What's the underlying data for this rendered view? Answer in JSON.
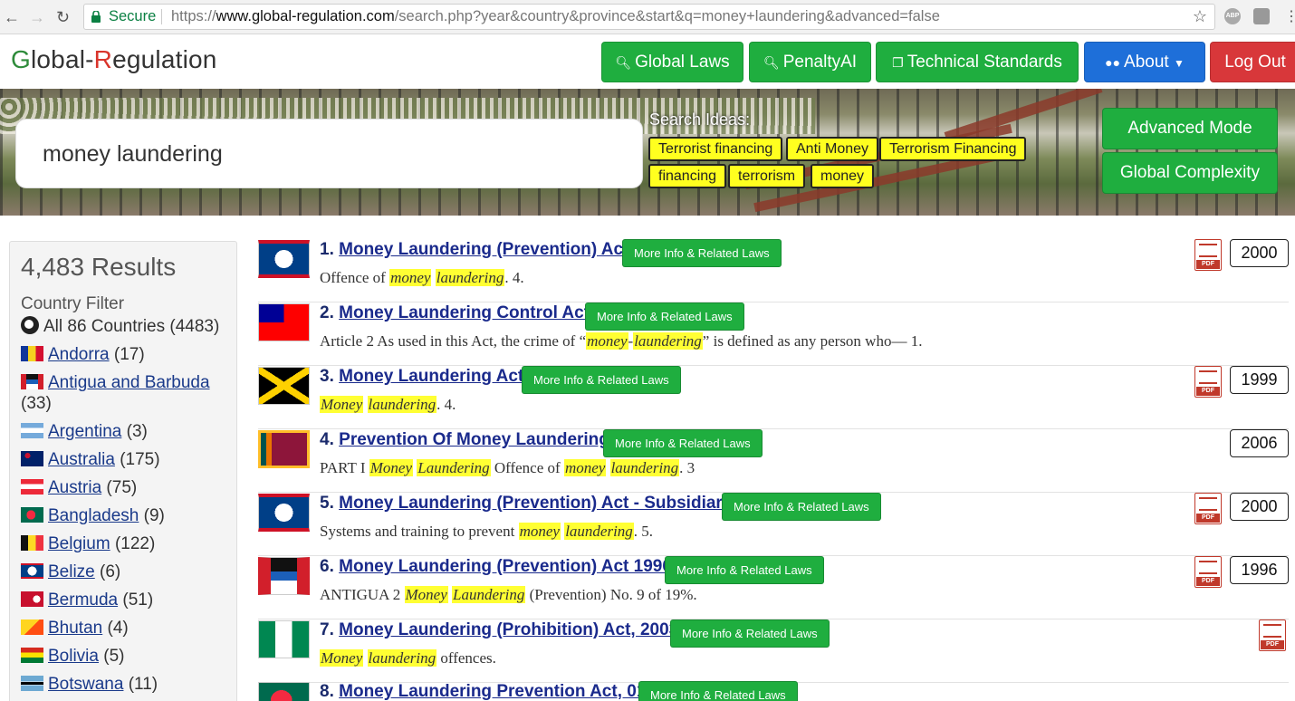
{
  "browser": {
    "secure_label": "Secure",
    "url_scheme": "https://",
    "url_domain": "www.global-regulation.com",
    "url_path": "/search.php?year&country&province&start&q=money+laundering&advanced=false",
    "ext1": "ABP"
  },
  "header": {
    "logo_g": "G",
    "logo_part1": "lobal-",
    "logo_r": "R",
    "logo_part2": "egulation",
    "nav": {
      "global_laws": "Global Laws",
      "penalty_ai": "PenaltyAI",
      "technical_standards": "Technical Standards",
      "about": "About",
      "logout": "Log Out"
    }
  },
  "search": {
    "query": "money laundering",
    "ideas_label": "Search Ideas:",
    "ideas": [
      "Terrorist financing",
      "Anti Money",
      "Terrorism Financing",
      "financing",
      "terrorism",
      "money"
    ],
    "advanced_mode": "Advanced Mode",
    "global_complexity": "Global Complexity"
  },
  "sidebar": {
    "results_count": "4,483 Results",
    "filter_label": "Country Filter",
    "all_label": "All 86 Countries (4483)",
    "countries": [
      {
        "name": "Andorra",
        "count": "(17)"
      },
      {
        "name": "Antigua and Barbuda",
        "count": "(33)"
      },
      {
        "name": "Argentina",
        "count": "(3)"
      },
      {
        "name": "Australia",
        "count": "(175)"
      },
      {
        "name": "Austria",
        "count": "(75)"
      },
      {
        "name": "Bangladesh",
        "count": "(9)"
      },
      {
        "name": "Belgium",
        "count": "(122)"
      },
      {
        "name": "Belize",
        "count": "(6)"
      },
      {
        "name": "Bermuda",
        "count": "(51)"
      },
      {
        "name": "Bhutan",
        "count": "(4)"
      },
      {
        "name": "Bolivia",
        "count": "(5)"
      },
      {
        "name": "Botswana",
        "count": "(11)"
      }
    ]
  },
  "results": {
    "more_label": "More Info & Related Laws",
    "pdf_label": "PDF",
    "items": [
      {
        "num": "1.",
        "title": "Money Laundering (Prevention) Act",
        "year": "2000",
        "s": [
          "Offence of ",
          "money",
          " ",
          "laundering",
          ". 4."
        ]
      },
      {
        "num": "2.",
        "title": "Money Laundering Control Act",
        "year": "",
        "s": [
          "Article 2 As used in this Act, the crime of “",
          "money",
          "-",
          "laundering",
          "” is defined as any person who— 1."
        ]
      },
      {
        "num": "3.",
        "title": "Money Laundering Act",
        "year": "1999",
        "s": [
          "",
          "Money",
          " ",
          "laundering",
          ". 4."
        ]
      },
      {
        "num": "4.",
        "title": "Prevention Of Money Laundering",
        "year": "2006",
        "s": [
          "PART I ",
          "Money",
          " ",
          "Laundering",
          " Offence of ",
          "money",
          " ",
          "laundering",
          ". 3"
        ]
      },
      {
        "num": "5.",
        "title": "Money Laundering (Prevention) Act - Subsidiary",
        "year": "2000",
        "s": [
          "Systems and training to prevent ",
          "money",
          " ",
          "laundering",
          ". 5."
        ]
      },
      {
        "num": "6.",
        "title": "Money Laundering (Prevention) Act 1996",
        "year": "1996",
        "s": [
          "ANTIGUA 2 ",
          "Money",
          " ",
          "Laundering",
          " (Prevention) No. 9 of 19%."
        ]
      },
      {
        "num": "7.",
        "title": "Money Laundering (Prohibition) Act, 2003",
        "year": "",
        "s": [
          "",
          "Money",
          " ",
          "laundering",
          " offences."
        ]
      },
      {
        "num": "8.",
        "title": "Money Laundering Prevention Act, 01",
        "year": "",
        "s": [
          "",
          "",
          "",
          "",
          ""
        ]
      }
    ]
  },
  "colors": {
    "green": "#1fae3f",
    "blue": "#1e6fd9",
    "red": "#d8373a",
    "highlight": "#ffff33"
  }
}
